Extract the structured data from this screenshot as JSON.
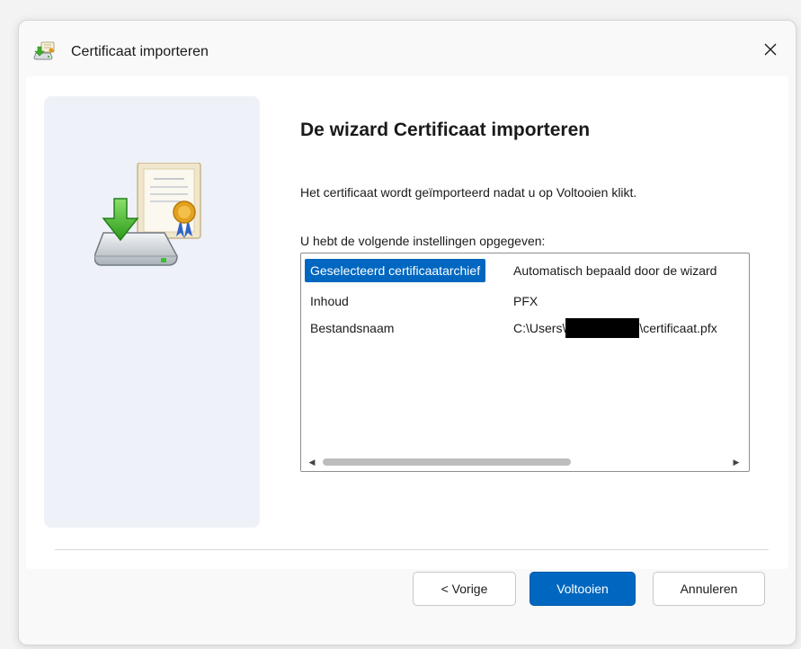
{
  "window": {
    "title": "Certificaat importeren",
    "close_symbol": "✕"
  },
  "icons": {
    "app": "certificate-import-icon",
    "wizard": "certificate-import-wizard-icon",
    "close": "close-icon"
  },
  "main": {
    "heading": "De wizard Certificaat importeren",
    "description": "Het certificaat wordt geïmporteerd nadat u op Voltooien klikt.",
    "list_label": "U hebt de volgende instellingen opgegeven:"
  },
  "settings": [
    {
      "name": "Geselecteerd certificaatarchief",
      "value": "Automatisch bepaald door de wizard",
      "selected": true
    },
    {
      "name": "Inhoud",
      "value": "PFX",
      "selected": false
    },
    {
      "name": "Bestandsnaam",
      "value_prefix": "C:\\Users\\",
      "value_suffix": "\\certificaat.pfx",
      "redacted": true,
      "selected": false
    }
  ],
  "scrollbar": {
    "left_arrow": "◀",
    "right_arrow": "▶"
  },
  "buttons": {
    "back": "< Vorige",
    "finish": "Voltooien",
    "cancel": "Annuleren"
  },
  "colors": {
    "accent": "#0067c0",
    "side_panel": "#eef2f8"
  }
}
